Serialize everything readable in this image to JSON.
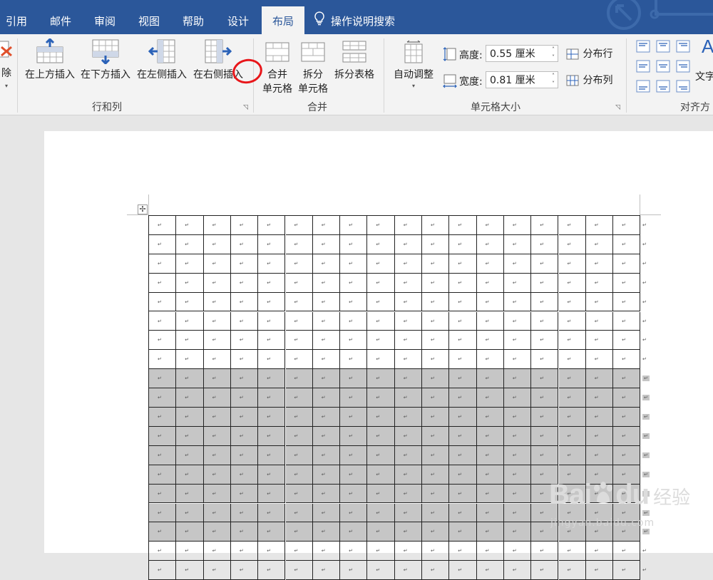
{
  "tabs": [
    {
      "label": "引用"
    },
    {
      "label": "邮件"
    },
    {
      "label": "审阅"
    },
    {
      "label": "视图"
    },
    {
      "label": "帮助"
    },
    {
      "label": "设计"
    },
    {
      "label": "布局",
      "active": true
    }
  ],
  "search": {
    "label": "操作说明搜索"
  },
  "ribbon": {
    "rows_cols": {
      "delete_label": "除",
      "insert_above": "在上方插入",
      "insert_below": "在下方插入",
      "insert_left": "在左侧插入",
      "insert_right": "在右侧插入",
      "group_label": "行和列"
    },
    "merge": {
      "merge_cells_line1": "合并",
      "merge_cells_line2": "单元格",
      "split_cells_line1": "拆分",
      "split_cells_line2": "单元格",
      "split_table": "拆分表格",
      "group_label": "合并"
    },
    "cell_size": {
      "autofit": "自动调整",
      "height_label": "高度:",
      "height_value": "0.55 厘米",
      "width_label": "宽度:",
      "width_value": "0.81 厘米",
      "distribute_rows": "分布行",
      "distribute_cols": "分布列",
      "group_label": "单元格大小"
    },
    "alignment": {
      "text_dir": "文字",
      "group_label": "对齐方"
    }
  },
  "table": {
    "cell_mark": "↵",
    "rows": 19,
    "cols": 18,
    "selected_row_start": 8,
    "selected_row_end": 16
  },
  "watermark": {
    "brand": "Bai",
    "brand2": "du",
    "cn": "经验",
    "url": "jingyan.baidu.com"
  },
  "colors": {
    "tab_bar": "#2b579a",
    "ribbon": "#f3f3f3",
    "selection": "#c6c6c6",
    "annotation": "#e8161a"
  }
}
